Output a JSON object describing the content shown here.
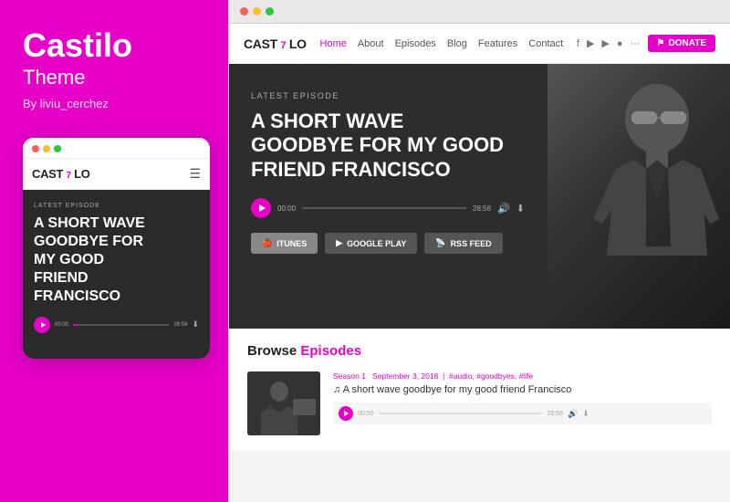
{
  "left": {
    "brand": {
      "title": "Castilo",
      "subtitle": "Theme",
      "author": "By liviu_cerchez"
    },
    "mobile": {
      "logo": "CAST",
      "logo_accent": "7",
      "logo_suffix": "LO",
      "episode_label": "LATEST EPISODE",
      "episode_title": "A SHORT WAVE GOODBYE FOR MY GOOD FRIEND FRANCISCO",
      "time_start": "00:00",
      "time_end": "28:56"
    }
  },
  "right": {
    "browser_dots": [
      "red",
      "yellow",
      "green"
    ],
    "header": {
      "logo": "CAST",
      "logo_accent": "7",
      "logo_suffix": "LO",
      "nav": [
        "Home",
        "About",
        "Episodes",
        "Blog",
        "Features",
        "Contact"
      ],
      "active_nav": "Home",
      "donate_label": "DONATE"
    },
    "hero": {
      "latest_label": "LATEST EPISODE",
      "title": "A SHORT WAVE GOODBYE FOR MY GOOD FRIEND FRANCISCO",
      "time_start": "00:00",
      "time_end": "28:56",
      "buttons": [
        "ITUNES",
        "GOOGLE PLAY",
        "RSS FEED"
      ]
    },
    "browse": {
      "title": "Browse",
      "title_accent": "Episodes",
      "episode": {
        "meta": "Season 1  •  September 3, 2018  •  #audio, #goodbyes, #life",
        "title": "♫  A short wave goodbye for my good friend Francisco",
        "time_start": "00:00",
        "time_end": "28:56"
      }
    }
  }
}
